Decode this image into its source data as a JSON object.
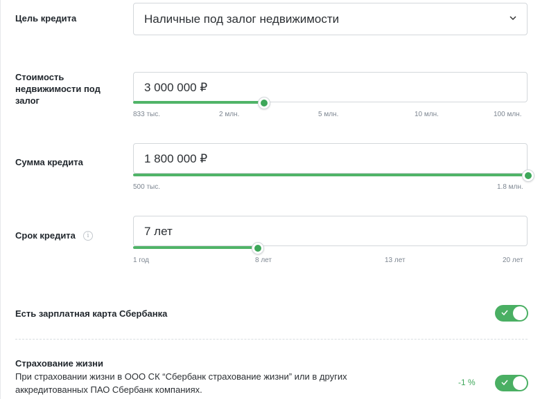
{
  "purpose": {
    "label": "Цель кредита",
    "value": "Наличные под залог недвижимости",
    "chevron_icon": "chevron-down-icon"
  },
  "property_value": {
    "label_line1": "Стоимость",
    "label_line2": "недвижимости под",
    "label_line3": "залог",
    "value": "3 000 000 ₽",
    "slider_fraction": 0.33,
    "ticks": [
      "833 тыс.",
      "2 млн.",
      "5 млн.",
      "10 млн.",
      "100 млн."
    ]
  },
  "loan_amount": {
    "label": "Сумма кредита",
    "value": "1 800 000 ₽",
    "slider_fraction": 1.0,
    "ticks": [
      "500 тыс.",
      "1.8 млн."
    ]
  },
  "loan_term": {
    "label": "Срок кредита",
    "info_icon": "info-icon",
    "value": "7 лет",
    "slider_fraction": 0.31,
    "ticks": [
      "1 год",
      "8 лет",
      "13 лет",
      "20 лет"
    ]
  },
  "salary_card": {
    "label": "Есть зарплатная карта Сбербанка",
    "toggle_on": true
  },
  "life_insurance": {
    "label": "Страхование жизни",
    "description_line1": "При страховании жизни в ООО СК “Сбербанк страхование жизни” или в других",
    "description_line2": "аккредитованных ПАО Сбербанк компаниях.",
    "discount": "-1 %",
    "toggle_on": true
  },
  "colors": {
    "accent": "#3ea75a",
    "track": "#50b468",
    "border": "#d3d7db"
  }
}
